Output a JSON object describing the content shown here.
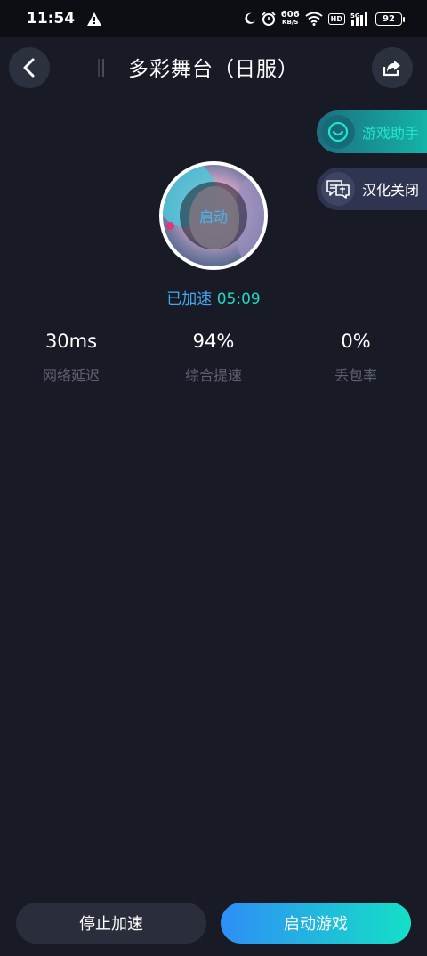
{
  "status_bar": {
    "time": "11:54",
    "net_speed_value": "606",
    "net_speed_unit": "KB/S",
    "hd_badge": "HD",
    "signal_label": "5G",
    "battery": "92",
    "icons": [
      "warning-icon",
      "moon-icon",
      "alarm-icon",
      "wifi-icon",
      "signal-icon",
      "battery-icon"
    ]
  },
  "header": {
    "title": "多彩舞台（日服）",
    "back_icon": "chevron-left-icon",
    "share_icon": "share-icon"
  },
  "side_actions": [
    {
      "label": "游戏助手",
      "icon": "assistant-icon"
    },
    {
      "label": "汉化关闭",
      "icon": "translate-icon"
    }
  ],
  "game": {
    "overlay_label": "启动",
    "accel_label": "已加速",
    "accel_time": "05:09"
  },
  "stats": [
    {
      "value": "30ms",
      "label": "网络延迟"
    },
    {
      "value": "94%",
      "label": "综合提速"
    },
    {
      "value": "0%",
      "label": "丢包率"
    }
  ],
  "actions": {
    "stop_label": "停止加速",
    "launch_label": "启动游戏"
  },
  "colors": {
    "background": "#181a26",
    "accent_blue": "#46a9f0",
    "accent_teal": "#21d9c4",
    "muted_text": "#5d6272"
  }
}
